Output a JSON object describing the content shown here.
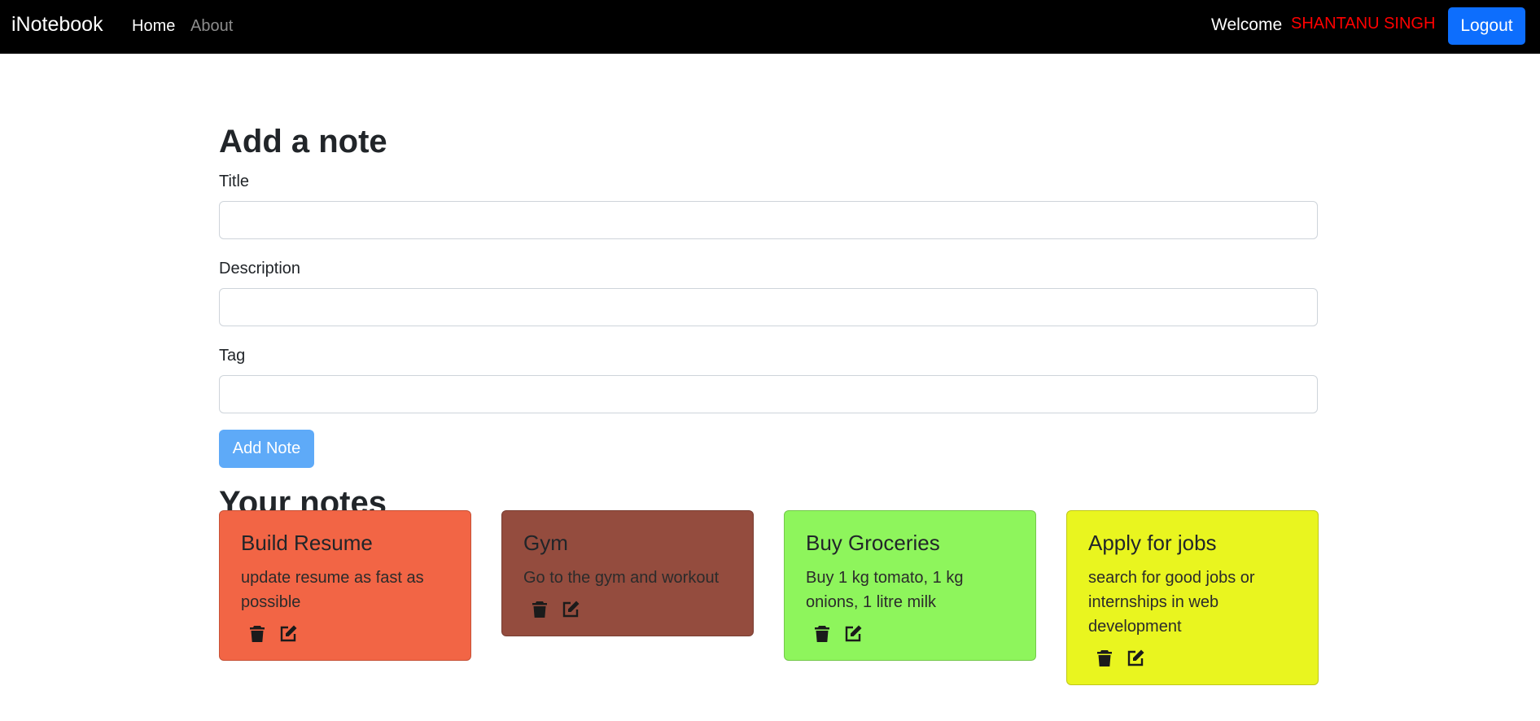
{
  "nav": {
    "brand": "iNotebook",
    "links": [
      "Home",
      "About"
    ],
    "welcome": "Welcome",
    "user_name": "SHANTANU SINGH",
    "logout_label": "Logout"
  },
  "form": {
    "heading": "Add a note",
    "fields": [
      {
        "label": "Title",
        "value": ""
      },
      {
        "label": "Description",
        "value": ""
      },
      {
        "label": "Tag",
        "value": ""
      }
    ],
    "submit_label": "Add Note"
  },
  "notes_section": {
    "heading": "Your notes",
    "notes": [
      {
        "title": "Build Resume",
        "description": "update resume as fast as possible",
        "color": "#f26545",
        "icons": [
          "trash-icon",
          "edit-icon"
        ]
      },
      {
        "title": "Gym",
        "description": "Go to the gym and workout",
        "color": "#944c3e",
        "icons": [
          "trash-icon",
          "edit-icon"
        ]
      },
      {
        "title": "Buy Groceries",
        "description": "Buy 1 kg tomato, 1 kg onions, 1 litre milk",
        "color": "#8ef55c",
        "icons": [
          "trash-icon",
          "edit-icon"
        ]
      },
      {
        "title": "Apply for jobs",
        "description": "search for good jobs or internships in web development",
        "color": "#e9f51f",
        "icons": [
          "trash-icon",
          "edit-icon"
        ]
      }
    ]
  },
  "colors": {
    "navbar_bg": "#000000",
    "accent": "#0d6efd",
    "add_button": "#5eaaf8",
    "username": "#ff0000"
  }
}
